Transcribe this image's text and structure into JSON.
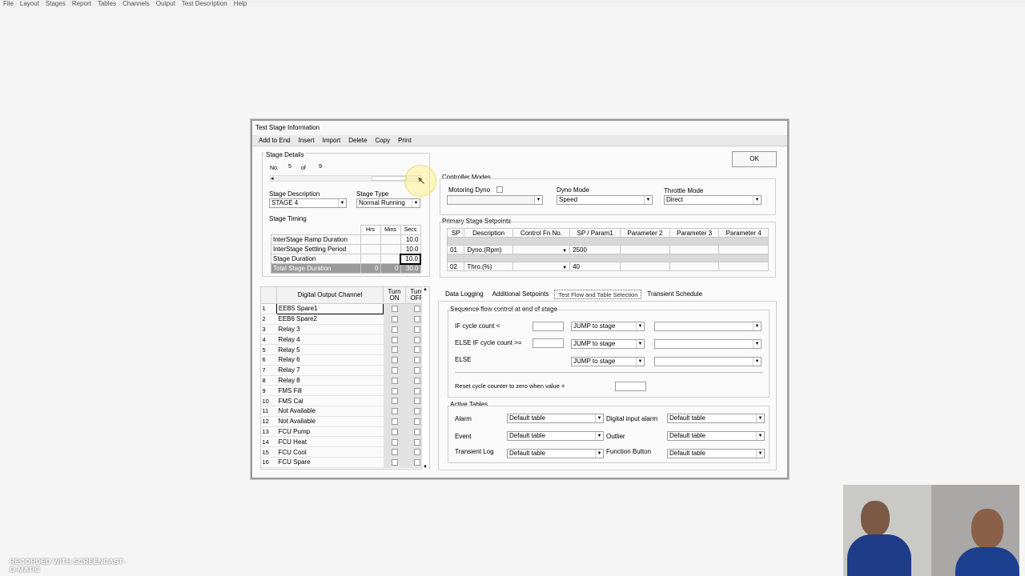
{
  "app_menu": [
    "File",
    "Layout",
    "Stages",
    "Report",
    "Tables",
    "Channels",
    "Output",
    "Test Description",
    "Help"
  ],
  "dialog": {
    "title": "Test Stage Information",
    "menu": [
      "Add to End",
      "Insert",
      "Import",
      "Delete",
      "Copy",
      "Print"
    ],
    "ok_label": "OK",
    "stage_details": {
      "group_label": "Stage Details",
      "no_label": "No.",
      "no_value": "5",
      "of_label": "of",
      "of_value": "9",
      "desc_label": "Stage Description",
      "desc_value": "STAGE 4",
      "type_label": "Stage Type",
      "type_value": "Normal Running"
    },
    "timing": {
      "group_label": "Stage Timing",
      "headers": [
        "Hrs",
        "Mins",
        "Secs"
      ],
      "rows": [
        {
          "label": "InterStage Ramp Duration",
          "hrs": "",
          "mins": "",
          "secs": "10.0"
        },
        {
          "label": "InterStage Settling Period",
          "hrs": "",
          "mins": "",
          "secs": "10.0"
        },
        {
          "label": "Stage Duration",
          "hrs": "",
          "mins": "",
          "secs": "10.0"
        },
        {
          "label": "Total Stage Duration",
          "hrs": "0",
          "mins": "0",
          "secs": "30.0"
        }
      ]
    },
    "digital_outputs": {
      "headers": {
        "channel": "Digital Output Channel",
        "on": "Turn ON",
        "off": "Turn OFF"
      },
      "rows": [
        {
          "n": "1",
          "name": "EEB5 Spare1"
        },
        {
          "n": "2",
          "name": "EEB6 Spare2"
        },
        {
          "n": "3",
          "name": "Relay 3"
        },
        {
          "n": "4",
          "name": "Relay 4"
        },
        {
          "n": "5",
          "name": "Relay 5"
        },
        {
          "n": "6",
          "name": "Relay 6"
        },
        {
          "n": "7",
          "name": "Relay 7"
        },
        {
          "n": "8",
          "name": "Relay 8"
        },
        {
          "n": "9",
          "name": "FMS Fill"
        },
        {
          "n": "10",
          "name": "FMS Cal"
        },
        {
          "n": "11",
          "name": "Not Available"
        },
        {
          "n": "12",
          "name": "Not Available"
        },
        {
          "n": "13",
          "name": "FCU Pump"
        },
        {
          "n": "14",
          "name": "FCU Heat"
        },
        {
          "n": "15",
          "name": "FCU Cool"
        },
        {
          "n": "16",
          "name": "FCU Spare"
        }
      ]
    },
    "controller": {
      "group_label": "Controller Modes",
      "motoring_label": "Motoring Dyno",
      "motoring_value": "",
      "dyno_label": "Dyno Mode",
      "dyno_value": "Speed",
      "throttle_label": "Throttle Mode",
      "throttle_value": "Direct"
    },
    "setpoints": {
      "group_label": "Primary Stage Setpoints",
      "headers": [
        "SP",
        "Description",
        "Control Fn No.",
        "SP / Param1",
        "Parameter 2",
        "Parameter 3",
        "Parameter 4"
      ],
      "rows": [
        {
          "sp": "01",
          "desc": "Dyno.(Rpm)",
          "fn": "",
          "p1": "2500"
        },
        {
          "sp": "02",
          "desc": "Thro.(%)",
          "fn": "",
          "p1": "40"
        }
      ]
    },
    "tabs": [
      "Data Logging",
      "Additional Setpoints",
      "Test Flow and Table Selection",
      "Transient Schedule"
    ],
    "flow": {
      "group_label": "Sequence flow control at end of stage",
      "if_label": "IF cycle count <",
      "elseif_label": "ELSE IF cycle count >=",
      "else_label": "ELSE",
      "jump_value": "JUMP to stage",
      "reset_label": "Reset cycle counter to zero when value  ="
    },
    "active_tables": {
      "group_label": "Active Tables",
      "alarm_label": "Alarm",
      "event_label": "Event",
      "transient_label": "Transient Log",
      "digital_alarm_label": "Digital input alarm",
      "outlier_label": "Outlier",
      "function_label": "Function Button",
      "default_value": "Default table"
    }
  },
  "watermark": "RECORDED WITH SCREENCAST-O-MATIC"
}
